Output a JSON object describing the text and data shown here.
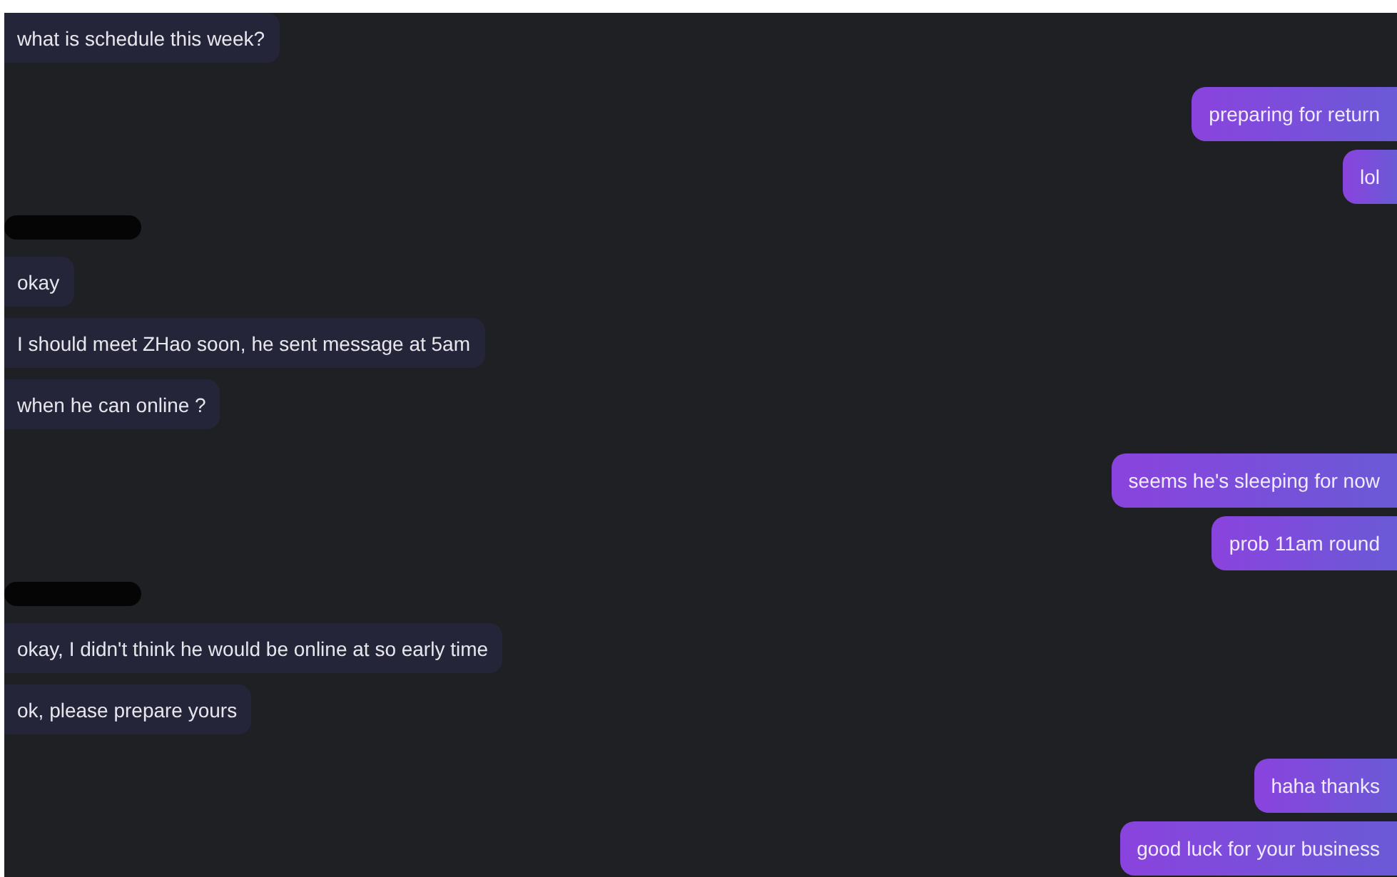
{
  "messages": [
    {
      "kind": "incoming",
      "text": "what is schedule this week?"
    },
    {
      "kind": "outgoing",
      "text": "preparing for return"
    },
    {
      "kind": "outgoing",
      "text": "lol"
    },
    {
      "kind": "redaction"
    },
    {
      "kind": "incoming",
      "text": "okay"
    },
    {
      "kind": "incoming",
      "text": "I should meet ZHao soon, he sent message at 5am"
    },
    {
      "kind": "incoming",
      "text": "when he can online ?"
    },
    {
      "kind": "outgoing",
      "text": "seems he's sleeping for now"
    },
    {
      "kind": "outgoing",
      "text": "prob 11am round"
    },
    {
      "kind": "redaction"
    },
    {
      "kind": "incoming",
      "text": "okay, I didn't think he would be online at so early time"
    },
    {
      "kind": "incoming",
      "text": "ok, please prepare yours"
    },
    {
      "kind": "outgoing",
      "text": "haha thanks"
    },
    {
      "kind": "outgoing",
      "text": "good luck for your business"
    }
  ]
}
